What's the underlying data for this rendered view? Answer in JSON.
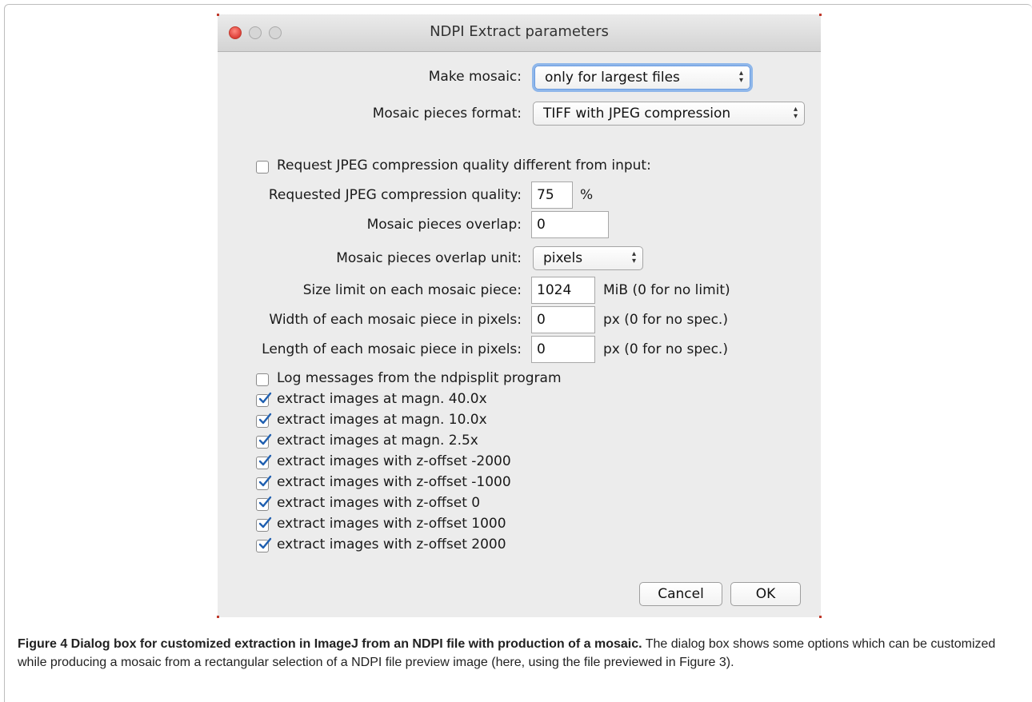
{
  "window": {
    "title": "NDPI Extract parameters"
  },
  "form": {
    "make_mosaic": {
      "label": "Make mosaic:",
      "value": "only for largest files"
    },
    "mosaic_format": {
      "label": "Mosaic pieces format:",
      "value": "TIFF with JPEG compression"
    },
    "request_jpeg": {
      "label": "Request JPEG compression quality different from input:",
      "checked": false
    },
    "jpeg_quality": {
      "label": "Requested JPEG compression quality:",
      "value": "75",
      "unit": "%"
    },
    "overlap": {
      "label": "Mosaic pieces overlap:",
      "value": "0"
    },
    "overlap_unit": {
      "label": "Mosaic pieces overlap unit:",
      "value": "pixels"
    },
    "size_limit": {
      "label": "Size limit on each mosaic piece:",
      "value": "1024",
      "unit": "MiB (0 for no limit)"
    },
    "width": {
      "label": "Width of each mosaic piece in pixels:",
      "value": "0",
      "unit": "px (0 for no spec.)"
    },
    "length": {
      "label": "Length of each mosaic piece in pixels:",
      "value": "0",
      "unit": "px (0 for no spec.)"
    },
    "checkboxes": [
      {
        "label": "Log messages from the ndpisplit program",
        "checked": false
      },
      {
        "label": "extract images at magn. 40.0x",
        "checked": true
      },
      {
        "label": "extract images at magn. 10.0x",
        "checked": true
      },
      {
        "label": "extract images at magn. 2.5x",
        "checked": true
      },
      {
        "label": "extract images with z-offset -2000",
        "checked": true
      },
      {
        "label": "extract images with z-offset -1000",
        "checked": true
      },
      {
        "label": "extract images with z-offset 0",
        "checked": true
      },
      {
        "label": "extract images with z-offset 1000",
        "checked": true
      },
      {
        "label": "extract images with z-offset 2000",
        "checked": true
      }
    ]
  },
  "buttons": {
    "cancel": "Cancel",
    "ok": "OK"
  },
  "caption": {
    "bold": "Figure 4 Dialog box for customized extraction in ImageJ from an NDPI file with production of a mosaic.",
    "text": " The dialog box shows some options which can be customized while producing a mosaic from a rectangular selection of a NDPI file preview image (here, using the file previewed in Figure 3)."
  },
  "colors": {
    "close_button": "#e0443e",
    "focus_ring": "#8fb7ea",
    "dialog_bg": "#ececec",
    "check_mark": "#1f5fb0"
  }
}
